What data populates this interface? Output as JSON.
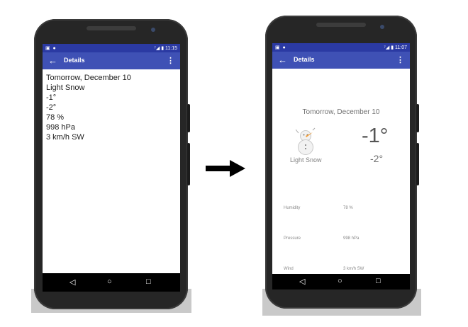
{
  "left_phone": {
    "status": {
      "icons_left": "▣ ●",
      "icons_right": "⁷◢ ▮",
      "time": "11:15"
    },
    "appbar": {
      "back": "←",
      "title": "Details",
      "menu": "⋮"
    },
    "content": [
      "Tomorrow, December 10",
      "Light Snow",
      "-1°",
      "-2°",
      "78 %",
      "998 hPa",
      "3 km/h SW"
    ],
    "nav": {
      "back": "◁",
      "home": "○",
      "recents": "□"
    }
  },
  "transition_arrow": "arrow-right-icon",
  "right_phone": {
    "status": {
      "icons_left": "▣ ●",
      "icons_right": "⁷◢ ▮",
      "time": "11:07"
    },
    "appbar": {
      "back": "←",
      "title": "Details",
      "menu": "⋮"
    },
    "forecast": {
      "date": "Tomorrow, December 10",
      "condition": "Light Snow",
      "high": "-1°",
      "low": "-2°",
      "icon": "snowman-icon"
    },
    "details": [
      {
        "label": "Humidity",
        "value": "78 %"
      },
      {
        "label": "Pressure",
        "value": "998 hPa"
      },
      {
        "label": "Wind",
        "value": "3 km/h SW"
      }
    ],
    "nav": {
      "back": "◁",
      "home": "○",
      "recents": "□"
    }
  },
  "colors": {
    "primary": "#3f51b5",
    "primary_dark": "#2b3aa3",
    "phone_body": "#262626",
    "backdrop": "#c9c9c9"
  }
}
